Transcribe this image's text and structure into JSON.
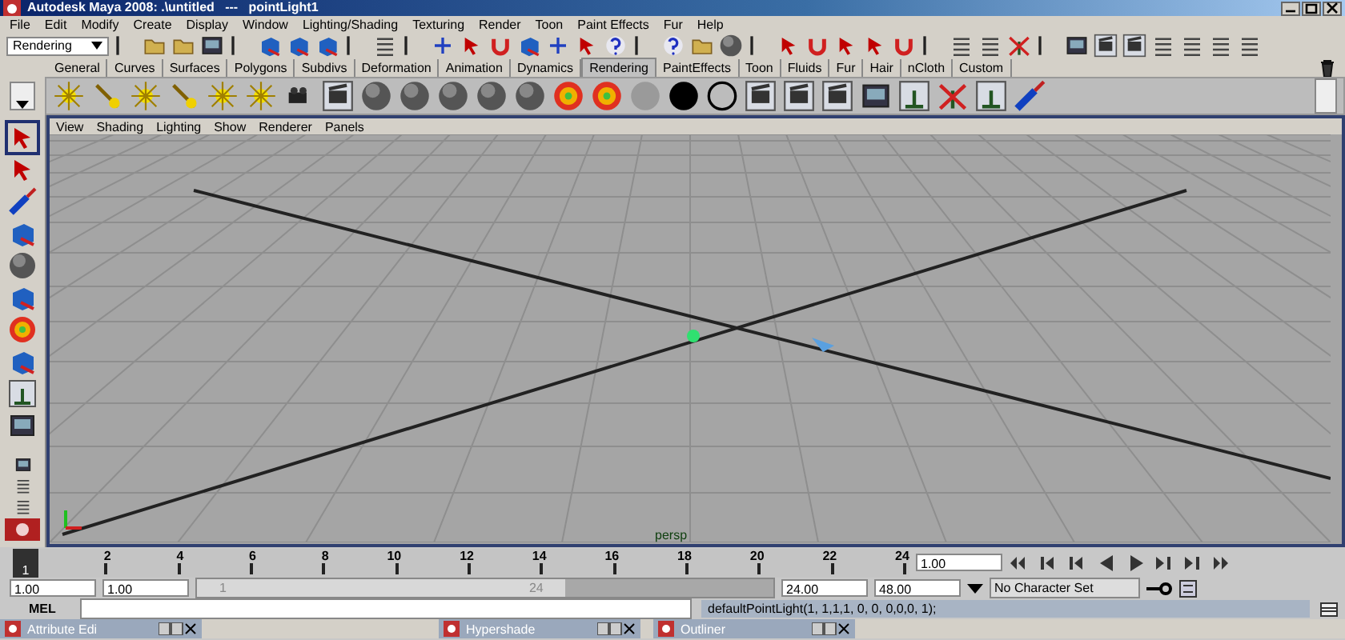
{
  "window": {
    "title": "Autodesk Maya 2008: .\\untitled   ---   pointLight1"
  },
  "menu_bar": [
    "File",
    "Edit",
    "Modify",
    "Create",
    "Display",
    "Window",
    "Lighting/Shading",
    "Texturing",
    "Render",
    "Toon",
    "Paint Effects",
    "Fur",
    "Help"
  ],
  "status_line": {
    "mode": "Rendering"
  },
  "shelf_tabs": [
    {
      "label": "General",
      "selected": false
    },
    {
      "label": "Curves",
      "selected": false
    },
    {
      "label": "Surfaces",
      "selected": false
    },
    {
      "label": "Polygons",
      "selected": false
    },
    {
      "label": "Subdivs",
      "selected": false
    },
    {
      "label": "Deformation",
      "selected": false
    },
    {
      "label": "Animation",
      "selected": false
    },
    {
      "label": "Dynamics",
      "selected": false
    },
    {
      "label": "Rendering",
      "selected": true
    },
    {
      "label": "PaintEffects",
      "selected": false
    },
    {
      "label": "Toon",
      "selected": false
    },
    {
      "label": "Fluids",
      "selected": false
    },
    {
      "label": "Fur",
      "selected": false
    },
    {
      "label": "Hair",
      "selected": false
    },
    {
      "label": "nCloth",
      "selected": false
    },
    {
      "label": "Custom",
      "selected": false
    }
  ],
  "panel_menu": [
    "View",
    "Shading",
    "Lighting",
    "Show",
    "Renderer",
    "Panels"
  ],
  "viewport": {
    "camera_label": "persp"
  },
  "time_slider": {
    "current_frame": "1",
    "frame_labels": [
      "2",
      "4",
      "6",
      "8",
      "10",
      "12",
      "14",
      "16",
      "18",
      "20",
      "22",
      "24"
    ],
    "current_time": "1.00",
    "level": 0
  },
  "range_slider": {
    "start_time": "1.00",
    "playback_start": "1.00",
    "range_start": "1",
    "range_end": "24",
    "level": 0.64,
    "playback_end": "24.00",
    "end_time": "48.00",
    "character_set": "No Character Set"
  },
  "command_line": {
    "label": "MEL",
    "result": "defaultPointLight(1, 1,1,1, 0, 0, 0,0,0, 1);"
  },
  "taskbar": [
    "Attribute Edi",
    "Hypershade",
    "Outliner"
  ]
}
